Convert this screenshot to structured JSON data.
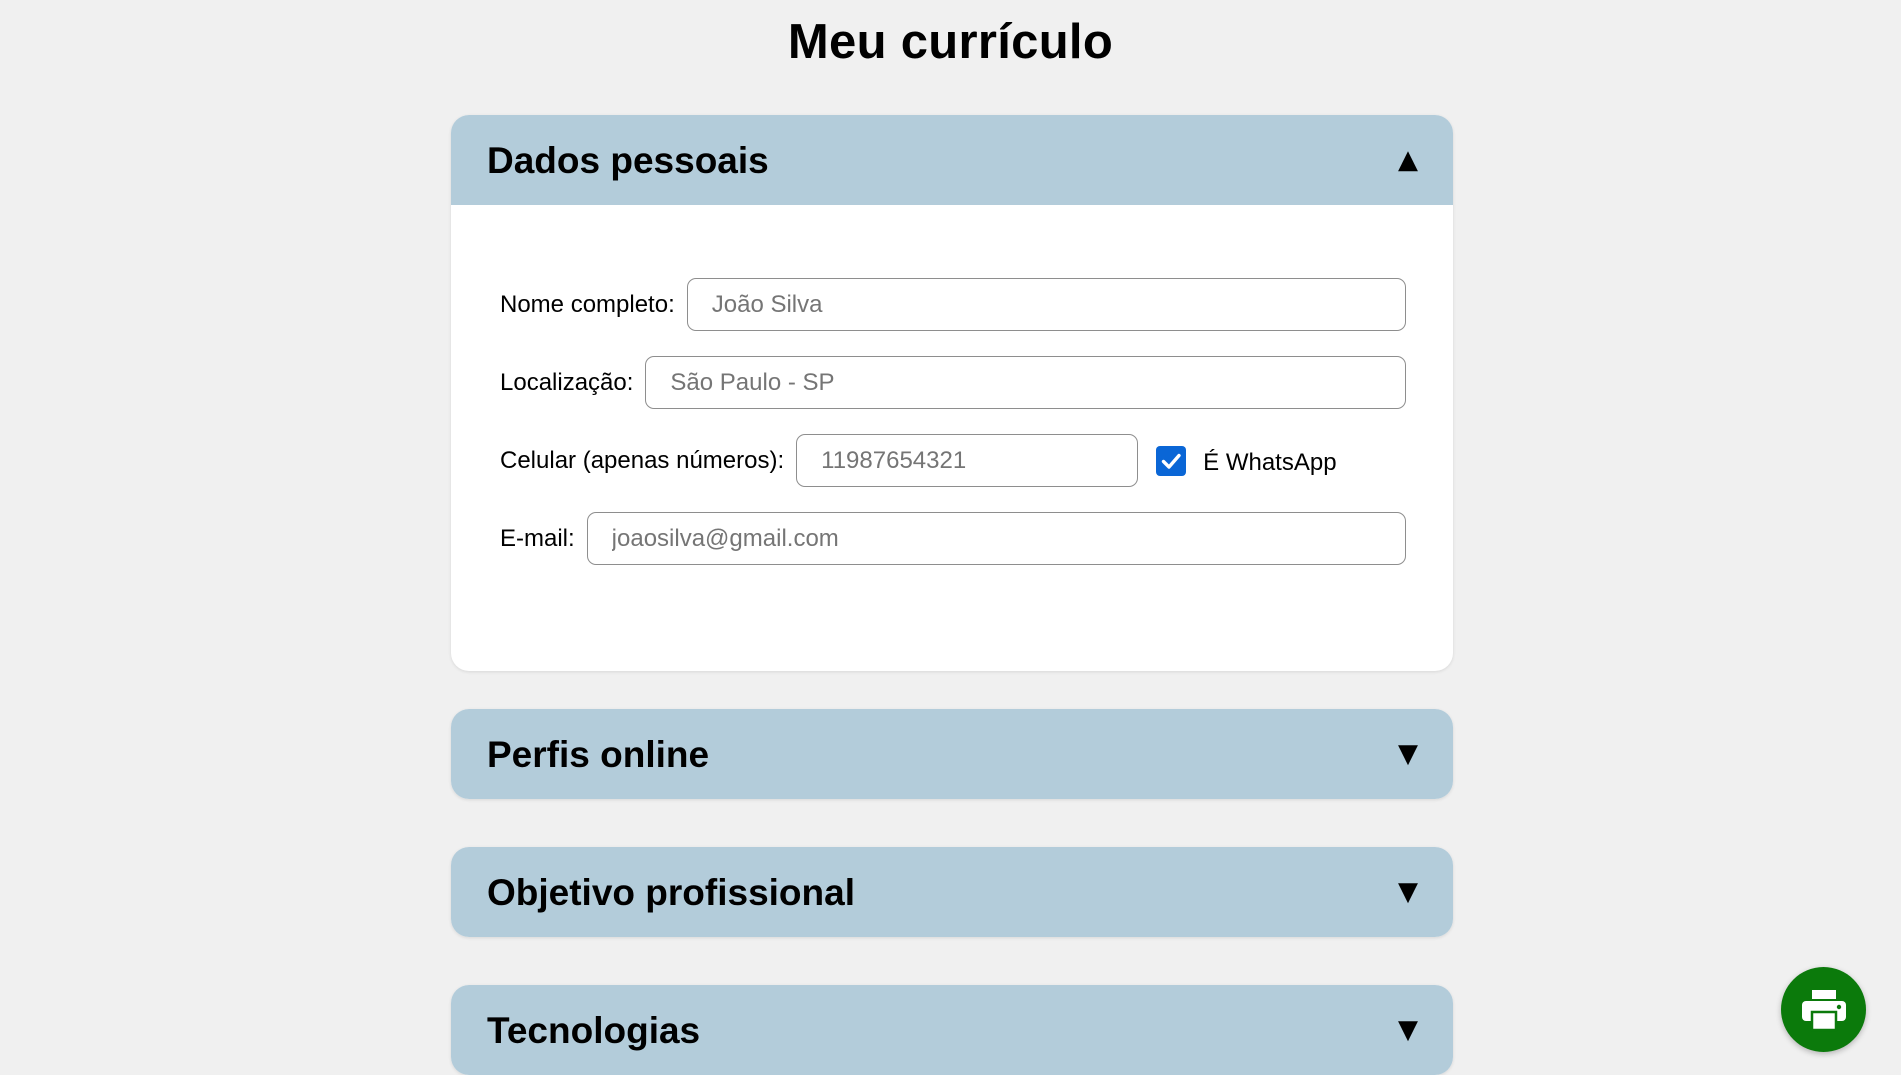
{
  "page": {
    "title": "Meu currículo"
  },
  "sections": [
    {
      "title": "Dados pessoais",
      "expanded": true,
      "chevron": "▲",
      "fields": {
        "nome": {
          "label": "Nome completo:",
          "value": "",
          "placeholder": "João Silva"
        },
        "localizacao": {
          "label": "Localização:",
          "value": "",
          "placeholder": "São Paulo - SP"
        },
        "celular": {
          "label": "Celular (apenas números):",
          "value": "",
          "placeholder": "11987654321"
        },
        "whatsapp": {
          "label": "É WhatsApp",
          "checked": true
        },
        "email": {
          "label": "E-mail:",
          "value": "",
          "placeholder": "joaosilva@gmail.com"
        }
      }
    },
    {
      "title": "Perfis online",
      "expanded": false,
      "chevron": "▼"
    },
    {
      "title": "Objetivo profissional",
      "expanded": false,
      "chevron": "▼"
    },
    {
      "title": "Tecnologias",
      "expanded": false,
      "chevron": "▼"
    }
  ],
  "print_button": {
    "icon": "printer-icon"
  },
  "colors": {
    "background": "#f0f0f0",
    "section_header": "#b3ccda",
    "checkbox": "#0a66d6",
    "print_button": "#0b7a0b"
  }
}
